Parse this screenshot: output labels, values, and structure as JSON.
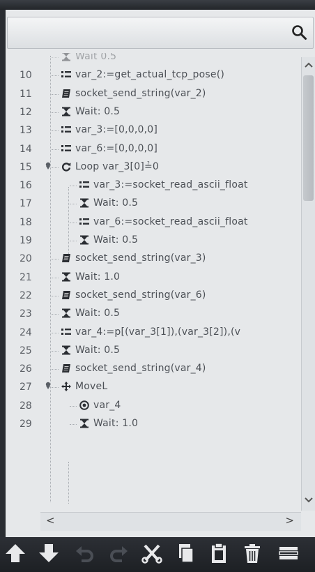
{
  "search": {
    "placeholder": ""
  },
  "tree_rows": [
    {
      "num": "",
      "label": "Wait 0.5",
      "icon": "hourglass-icon",
      "partial": true
    },
    {
      "num": "10",
      "label": "var_2:=get_actual_tcp_pose()",
      "icon": "assignment-icon"
    },
    {
      "num": "11",
      "label": "socket_send_string(var_2)",
      "icon": "script-icon"
    },
    {
      "num": "12",
      "label": "Wait: 0.5",
      "icon": "hourglass-icon"
    },
    {
      "num": "13",
      "label": "var_3:=[0,0,0,0]",
      "icon": "assignment-icon"
    },
    {
      "num": "14",
      "label": "var_6:=[0,0,0,0]",
      "icon": "assignment-icon"
    },
    {
      "num": "15",
      "label": "Loop var_3[0]≟0",
      "icon": "loop-icon",
      "expandable": true
    },
    {
      "num": "16",
      "label": "var_3:=socket_read_ascii_float",
      "icon": "assignment-icon",
      "nested": true
    },
    {
      "num": "17",
      "label": "Wait: 0.5",
      "icon": "hourglass-icon",
      "nested": true
    },
    {
      "num": "18",
      "label": "var_6:=socket_read_ascii_float",
      "icon": "assignment-icon",
      "nested": true
    },
    {
      "num": "19",
      "label": "Wait: 0.5",
      "icon": "hourglass-icon",
      "nested": true
    },
    {
      "num": "20",
      "label": "socket_send_string(var_3)",
      "icon": "script-icon"
    },
    {
      "num": "21",
      "label": "Wait: 1.0",
      "icon": "hourglass-icon"
    },
    {
      "num": "22",
      "label": "socket_send_string(var_6)",
      "icon": "script-icon"
    },
    {
      "num": "23",
      "label": "Wait: 0.5",
      "icon": "hourglass-icon"
    },
    {
      "num": "24",
      "label": "var_4:=p[(var_3[1]),(var_3[2]),(v",
      "icon": "assignment-icon"
    },
    {
      "num": "25",
      "label": "Wait: 0.5",
      "icon": "hourglass-icon"
    },
    {
      "num": "26",
      "label": "socket_send_string(var_4)",
      "icon": "script-icon"
    },
    {
      "num": "27",
      "label": "MoveL",
      "icon": "move-icon",
      "expandable": true
    },
    {
      "num": "28",
      "label": "var_4",
      "icon": "waypoint-icon",
      "nested": true
    },
    {
      "num": "29",
      "label": "Wait: 1.0",
      "icon": "hourglass-icon",
      "nested": true
    }
  ],
  "scroll": {
    "left_arrow": "<",
    "right_arrow": ">",
    "up_arrow": "^",
    "down_arrow": "v"
  },
  "toolbar": [
    {
      "name": "move-up-button",
      "icon": "arrow-up-icon"
    },
    {
      "name": "move-down-button",
      "icon": "arrow-down-icon"
    },
    {
      "name": "undo-button",
      "icon": "undo-icon"
    },
    {
      "name": "redo-button",
      "icon": "redo-icon"
    },
    {
      "name": "cut-button",
      "icon": "scissors-icon"
    },
    {
      "name": "copy-button",
      "icon": "copy-icon"
    },
    {
      "name": "paste-button",
      "icon": "clipboard-icon"
    },
    {
      "name": "delete-button",
      "icon": "trash-icon"
    },
    {
      "name": "suppress-button",
      "icon": "suppress-icon"
    }
  ],
  "colors": {
    "toolbar_icon": "#e8e9eb",
    "toolbar_icon_disabled": "#4a4e55",
    "panel": "#e6e8ea",
    "text": "#4c5056"
  }
}
